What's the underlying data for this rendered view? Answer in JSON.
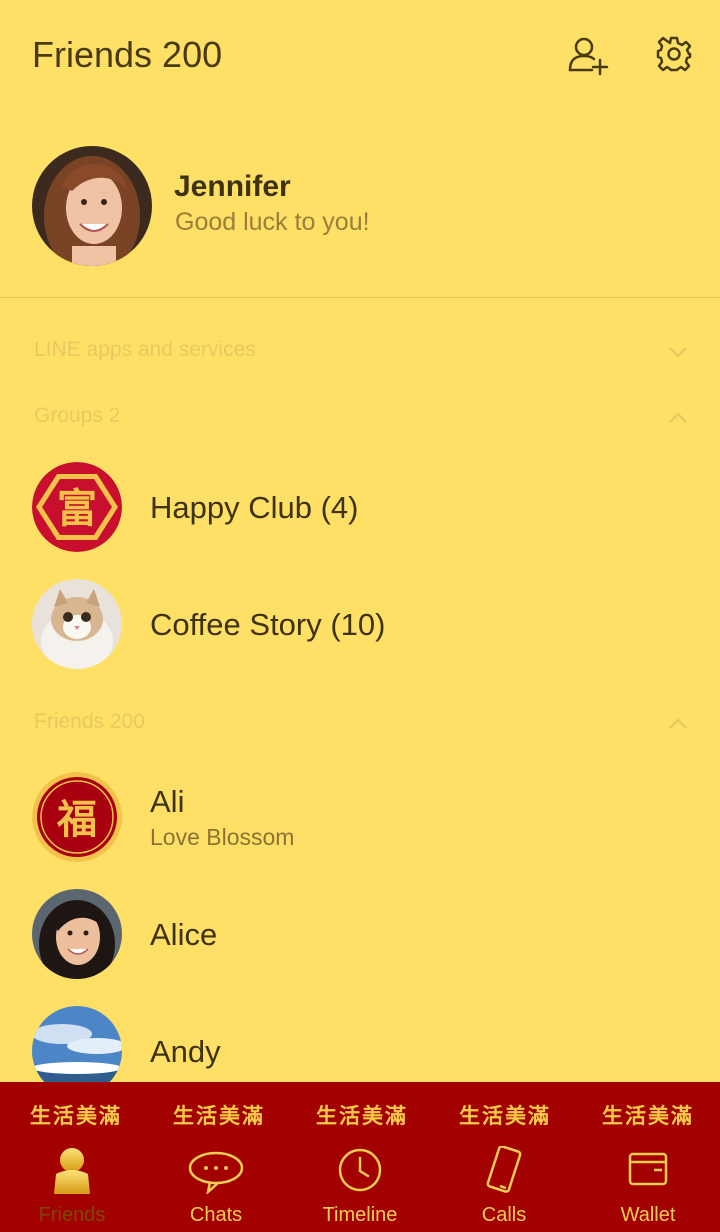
{
  "header": {
    "title": "Friends 200",
    "add_friend_icon": "add-friend-icon",
    "settings_icon": "gear-icon"
  },
  "profile": {
    "name": "Jennifer",
    "status": "Good luck to you!"
  },
  "sections": {
    "apps": "LINE apps and services",
    "groups": "Groups 2",
    "friends": "Friends 200"
  },
  "groups": [
    {
      "name": "Happy Club (4)"
    },
    {
      "name": "Coffee Story (10)"
    }
  ],
  "friends": [
    {
      "name": "Ali",
      "status": "Love Blossom"
    },
    {
      "name": "Alice"
    },
    {
      "name": "Andy"
    }
  ],
  "banner": {
    "deco": "生活美滿"
  },
  "tabs": [
    {
      "label": "Friends",
      "icon": "person-icon",
      "active": true
    },
    {
      "label": "Chats",
      "icon": "chat-bubble-icon"
    },
    {
      "label": "Timeline",
      "icon": "clock-icon"
    },
    {
      "label": "Calls",
      "icon": "phone-icon"
    },
    {
      "label": "Wallet",
      "icon": "wallet-icon"
    }
  ],
  "colors": {
    "background": "#ffe066",
    "banner": "#a30000",
    "accent_gold": "#f1cc52"
  }
}
